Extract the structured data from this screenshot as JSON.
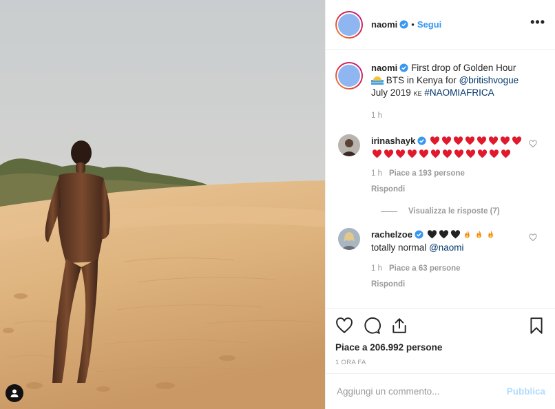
{
  "post": {
    "username": "naomi",
    "follow_label": "Segui",
    "dot": "•",
    "more_label": "•••"
  },
  "caption": {
    "username": "naomi",
    "text_1": "First drop of Golden Hour",
    "text_2": "BTS in Kenya for",
    "mention": "@britishvogue",
    "text_3": "July 2019",
    "kenya_flag": "KE",
    "hashtag": "#NAOMIAFRICA",
    "time": "1 h"
  },
  "comments": [
    {
      "username": "irinashayk",
      "hearts": 20,
      "time": "1 h",
      "likes": "Piace a 193 persone",
      "reply": "Rispondi",
      "view_replies": "Visualizza le risposte (7)"
    },
    {
      "username": "rachelzoe",
      "text": "totally normal",
      "mention": "@naomi",
      "time": "1 h",
      "likes": "Piace a 63 persone",
      "reply": "Rispondi"
    }
  ],
  "actions": {
    "likes_count": "Piace a 206.992 persone",
    "time_ago": "1 ora fa"
  },
  "add_comment": {
    "placeholder": "Aggiungi un commento...",
    "publish_label": "Pubblica"
  },
  "colors": {
    "accent": "#3897f0",
    "link": "#003569",
    "muted": "#999999",
    "border": "#efefef",
    "heart": "#e0192d"
  },
  "icons": [
    "user-tag-icon",
    "verified-badge-icon",
    "more-options-icon",
    "like-heart-icon",
    "comment-icon",
    "share-icon",
    "save-bookmark-icon"
  ]
}
